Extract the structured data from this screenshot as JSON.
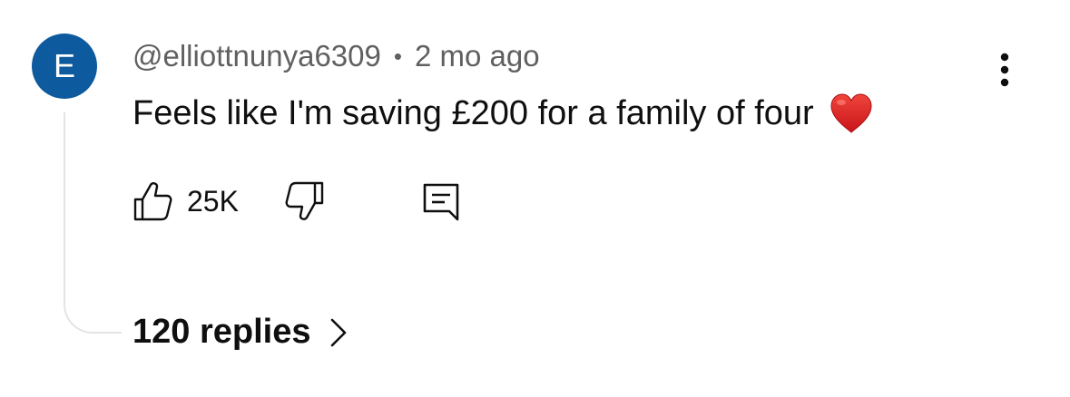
{
  "comment": {
    "avatar_letter": "E",
    "username": "@elliottnunya6309",
    "separator": "•",
    "time": "2 mo ago",
    "text": "Feels like I'm saving £200 for a family of four",
    "like_count": "25K",
    "replies_label": "120 replies"
  },
  "icons": {
    "heart": "heart-emoji-icon",
    "more": "vertical-dots-icon",
    "like": "thumbs-up-icon",
    "dislike": "thumbs-down-icon",
    "reply": "comment-bubble-icon",
    "chevron": "chevron-right-icon"
  },
  "colors": {
    "avatar_bg": "#0e5a9e",
    "meta_text": "#606060",
    "heart": "#e0201f"
  }
}
